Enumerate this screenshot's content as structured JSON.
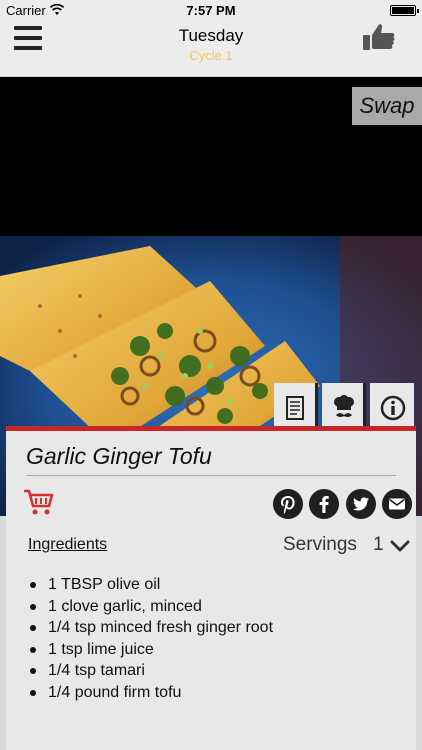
{
  "status_bar": {
    "carrier": "Carrier",
    "time": "7:57 PM",
    "battery_level": 1.0
  },
  "nav": {
    "title": "Tuesday",
    "subtitle": "Cycle 1",
    "subtitle_color": "#f0c860",
    "left_icon": "hamburger-menu-icon",
    "right_icon": "thumbs-up-icon"
  },
  "banner": {
    "swap_label": "Swap"
  },
  "photo": {
    "subject": "fried tofu slices with green onion relish"
  },
  "tabs": [
    {
      "icon": "recipe-card-icon"
    },
    {
      "icon": "chef-icon"
    },
    {
      "icon": "info-icon"
    }
  ],
  "recipe": {
    "title": "Garlic Ginger Tofu",
    "accent_color": "#c62828",
    "cart_icon": "shopping-cart-icon",
    "share_icons": [
      "pinterest-icon",
      "facebook-icon",
      "twitter-icon",
      "email-icon"
    ]
  },
  "ingredients": {
    "link_label": "Ingredients",
    "servings_label": "Servings",
    "servings_value": "1",
    "items": [
      "1 TBSP olive oil",
      "1 clove garlic, minced",
      "1/4 tsp minced fresh ginger root",
      "1 tsp lime juice",
      "1/4 tsp tamari",
      "1/4 pound firm tofu"
    ]
  }
}
